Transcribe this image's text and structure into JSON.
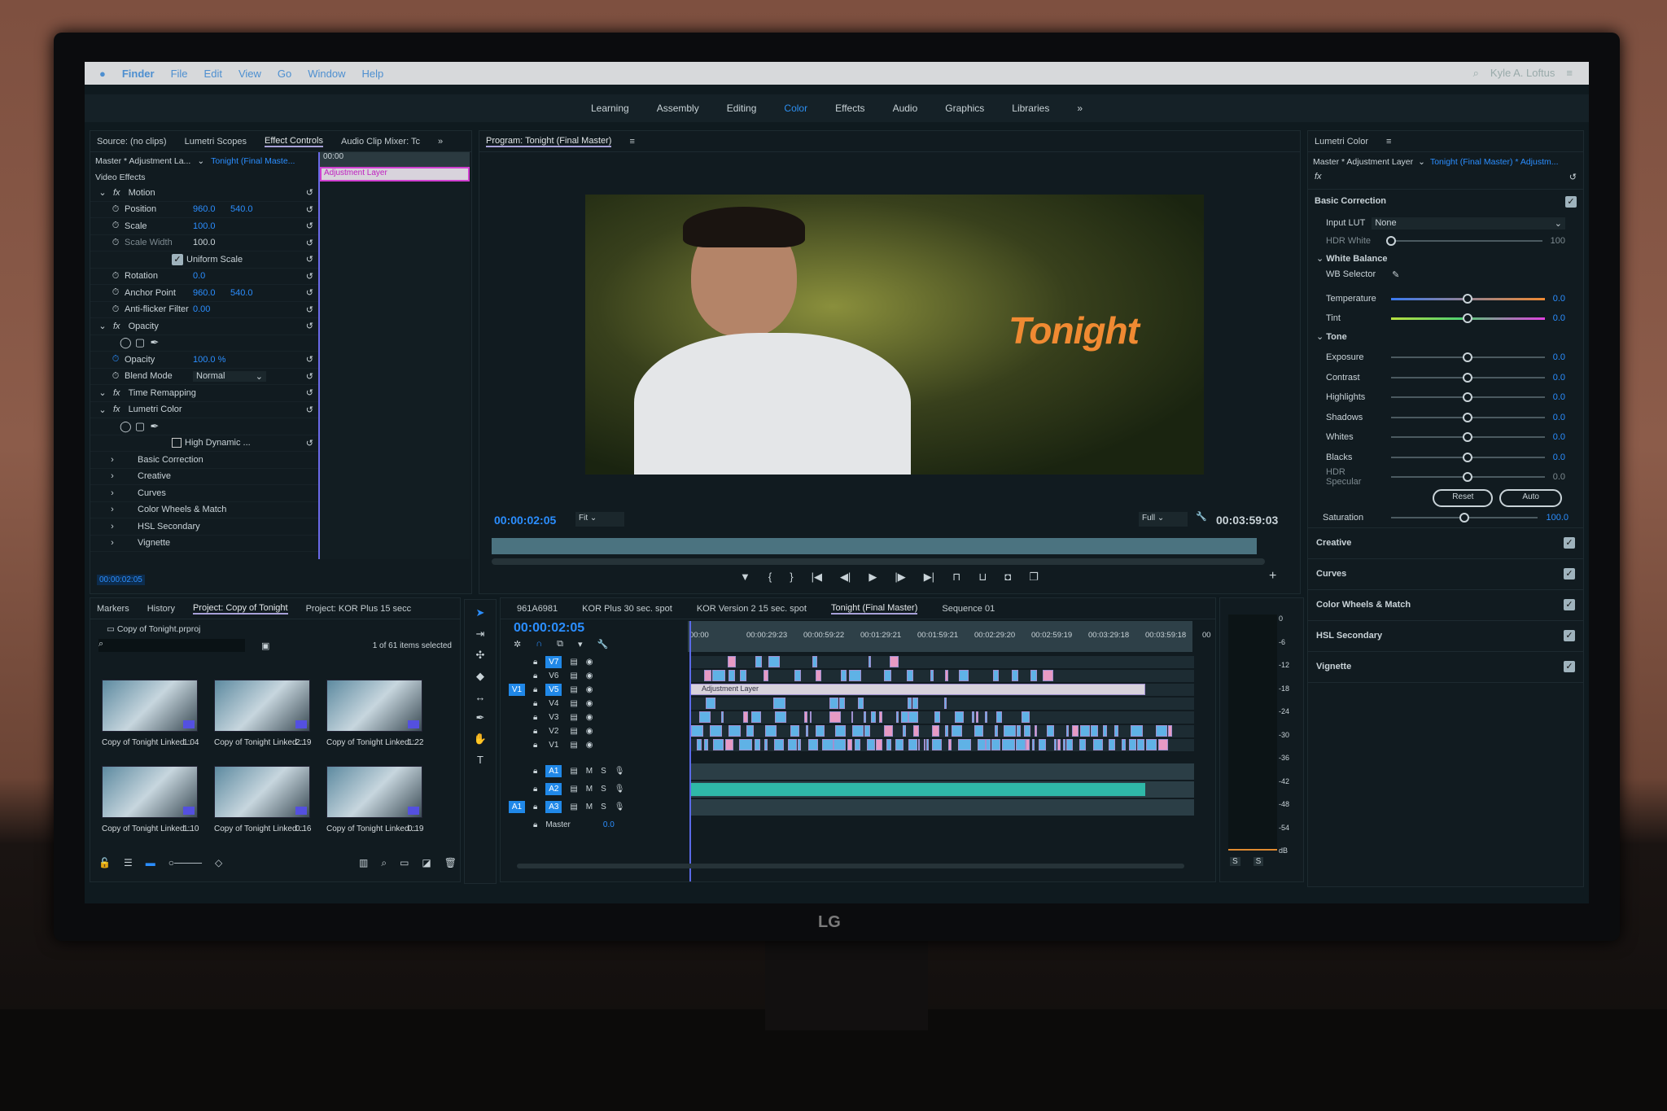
{
  "menubar": {
    "items": [
      "Finder",
      "File",
      "Edit",
      "View",
      "Go",
      "Window",
      "Help"
    ],
    "user": "Kyle A. Loftus"
  },
  "workspaces": {
    "items": [
      "Learning",
      "Assembly",
      "Editing",
      "Color",
      "Effects",
      "Audio",
      "Graphics",
      "Libraries"
    ],
    "active": "Color",
    "more": "»"
  },
  "effect_controls": {
    "tabs": [
      "Source: (no clips)",
      "Lumetri Scopes",
      "Effect Controls",
      "Audio Clip Mixer: Tc"
    ],
    "active_tab": "Effect Controls",
    "more": "»",
    "master": "Master * Adjustment La...",
    "sequence": "Tonight (Final Maste...",
    "ruler_time": "00:00",
    "clip_label": "Adjustment Layer",
    "section": "Video Effects",
    "rows": [
      {
        "name": "Motion",
        "kind": "fx"
      },
      {
        "name": "Position",
        "v1": "960.0",
        "v2": "540.0"
      },
      {
        "name": "Scale",
        "v1": "100.0"
      },
      {
        "name": "Scale Width",
        "v1": "100.0",
        "dim": true
      },
      {
        "name": "Uniform Scale",
        "kind": "check"
      },
      {
        "name": "Rotation",
        "v1": "0.0"
      },
      {
        "name": "Anchor Point",
        "v1": "960.0",
        "v2": "540.0"
      },
      {
        "name": "Anti-flicker Filter",
        "v1": "0.00"
      },
      {
        "name": "Opacity",
        "kind": "fx"
      },
      {
        "name": "",
        "kind": "masks"
      },
      {
        "name": "Opacity",
        "v1": "100.0 %"
      },
      {
        "name": "Blend Mode",
        "select": "Normal"
      },
      {
        "name": "Time Remapping",
        "kind": "fx"
      },
      {
        "name": "Lumetri Color",
        "kind": "fx"
      },
      {
        "name": "",
        "kind": "masks"
      },
      {
        "name": "High Dynamic ...",
        "kind": "check2"
      },
      {
        "name": "Basic Correction",
        "kind": "sub"
      },
      {
        "name": "Creative",
        "kind": "sub"
      },
      {
        "name": "Curves",
        "kind": "sub"
      },
      {
        "name": "Color Wheels & Match",
        "kind": "sub"
      },
      {
        "name": "HSL Secondary",
        "kind": "sub"
      },
      {
        "name": "Vignette",
        "kind": "sub"
      }
    ],
    "timecode": "00:00:02:05"
  },
  "program": {
    "title": "Program: Tonight (Final Master)",
    "overlay_text": "Tonight",
    "timecode": "00:00:02:05",
    "fit": "Fit",
    "quality": "Full",
    "duration": "00:03:59:03"
  },
  "lumetri": {
    "title": "Lumetri Color",
    "master": "Master * Adjustment Layer",
    "sequence": "Tonight (Final Master) * Adjustm...",
    "basic_correction": "Basic Correction",
    "input_lut_label": "Input LUT",
    "input_lut": "None",
    "hdr_white_label": "HDR White",
    "hdr_white": "100",
    "white_balance": "White Balance",
    "wb_selector": "WB Selector",
    "temperature": {
      "label": "Temperature",
      "value": "0.0"
    },
    "tint": {
      "label": "Tint",
      "value": "0.0"
    },
    "tone": "Tone",
    "tone_sliders": [
      {
        "label": "Exposure",
        "value": "0.0"
      },
      {
        "label": "Contrast",
        "value": "0.0"
      },
      {
        "label": "Highlights",
        "value": "0.0"
      },
      {
        "label": "Shadows",
        "value": "0.0"
      },
      {
        "label": "Whites",
        "value": "0.0"
      },
      {
        "label": "Blacks",
        "value": "0.0"
      },
      {
        "label": "HDR Specular",
        "value": "0.0",
        "dim": true
      }
    ],
    "reset": "Reset",
    "auto": "Auto",
    "saturation": {
      "label": "Saturation",
      "value": "100.0"
    },
    "sections": [
      {
        "label": "Creative",
        "checked": true
      },
      {
        "label": "Curves",
        "checked": true
      },
      {
        "label": "Color Wheels & Match",
        "checked": true
      },
      {
        "label": "HSL Secondary",
        "checked": true
      },
      {
        "label": "Vignette",
        "checked": true
      }
    ]
  },
  "project": {
    "tabs": [
      "Markers",
      "History",
      "Project: Copy of Tonight",
      "Project: KOR Plus 15 secc"
    ],
    "active_tab": "Project: Copy of Tonight",
    "file": "Copy of Tonight.prproj",
    "selection": "1 of 61 items selected",
    "items": [
      {
        "name": "Copy of Tonight Linked...",
        "dur": "1:04"
      },
      {
        "name": "Copy of Tonight Linked...",
        "dur": "2:19"
      },
      {
        "name": "Copy of Tonight Linked...",
        "dur": "1:22"
      },
      {
        "name": "Copy of Tonight Linked...",
        "dur": "1:10"
      },
      {
        "name": "Copy of Tonight Linked...",
        "dur": "0:16"
      },
      {
        "name": "Copy of Tonight Linked...",
        "dur": "0:19"
      }
    ]
  },
  "timeline": {
    "tabs": [
      "961A6981",
      "KOR Plus 30 sec. spot",
      "KOR Version 2 15 sec. spot",
      "Tonight (Final Master)",
      "Sequence 01"
    ],
    "active_tab": "Tonight (Final Master)",
    "timecode": "00:00:02:05",
    "ruler": [
      "00:00",
      "00:00:29:23",
      "00:00:59:22",
      "00:01:29:21",
      "00:01:59:21",
      "00:02:29:20",
      "00:02:59:19",
      "00:03:29:18",
      "00:03:59:18",
      "00"
    ],
    "video_tracks": [
      "V7",
      "V6",
      "V5",
      "V4",
      "V3",
      "V2",
      "V1"
    ],
    "audio_tracks": [
      "A1",
      "A2",
      "A3"
    ],
    "source_v": "V1",
    "source_a": "A1",
    "master_label": "Master",
    "master_value": "0.0",
    "adjustment_clip": "Adjustment Layer"
  },
  "meter": {
    "scale": [
      "0",
      "-6",
      "-12",
      "-18",
      "-24",
      "-30",
      "-36",
      "-42",
      "-48",
      "-54",
      "dB"
    ],
    "solo": [
      "S",
      "S"
    ]
  },
  "brand": "LG",
  "colors": {
    "accent": "#2b8eff",
    "video_clip": "#5fb2e6",
    "pink_clip": "#e79ac4",
    "audio_clip": "#2fb8a8",
    "adjustment": "#d8d3dc",
    "overlay_text": "#f08a32"
  }
}
